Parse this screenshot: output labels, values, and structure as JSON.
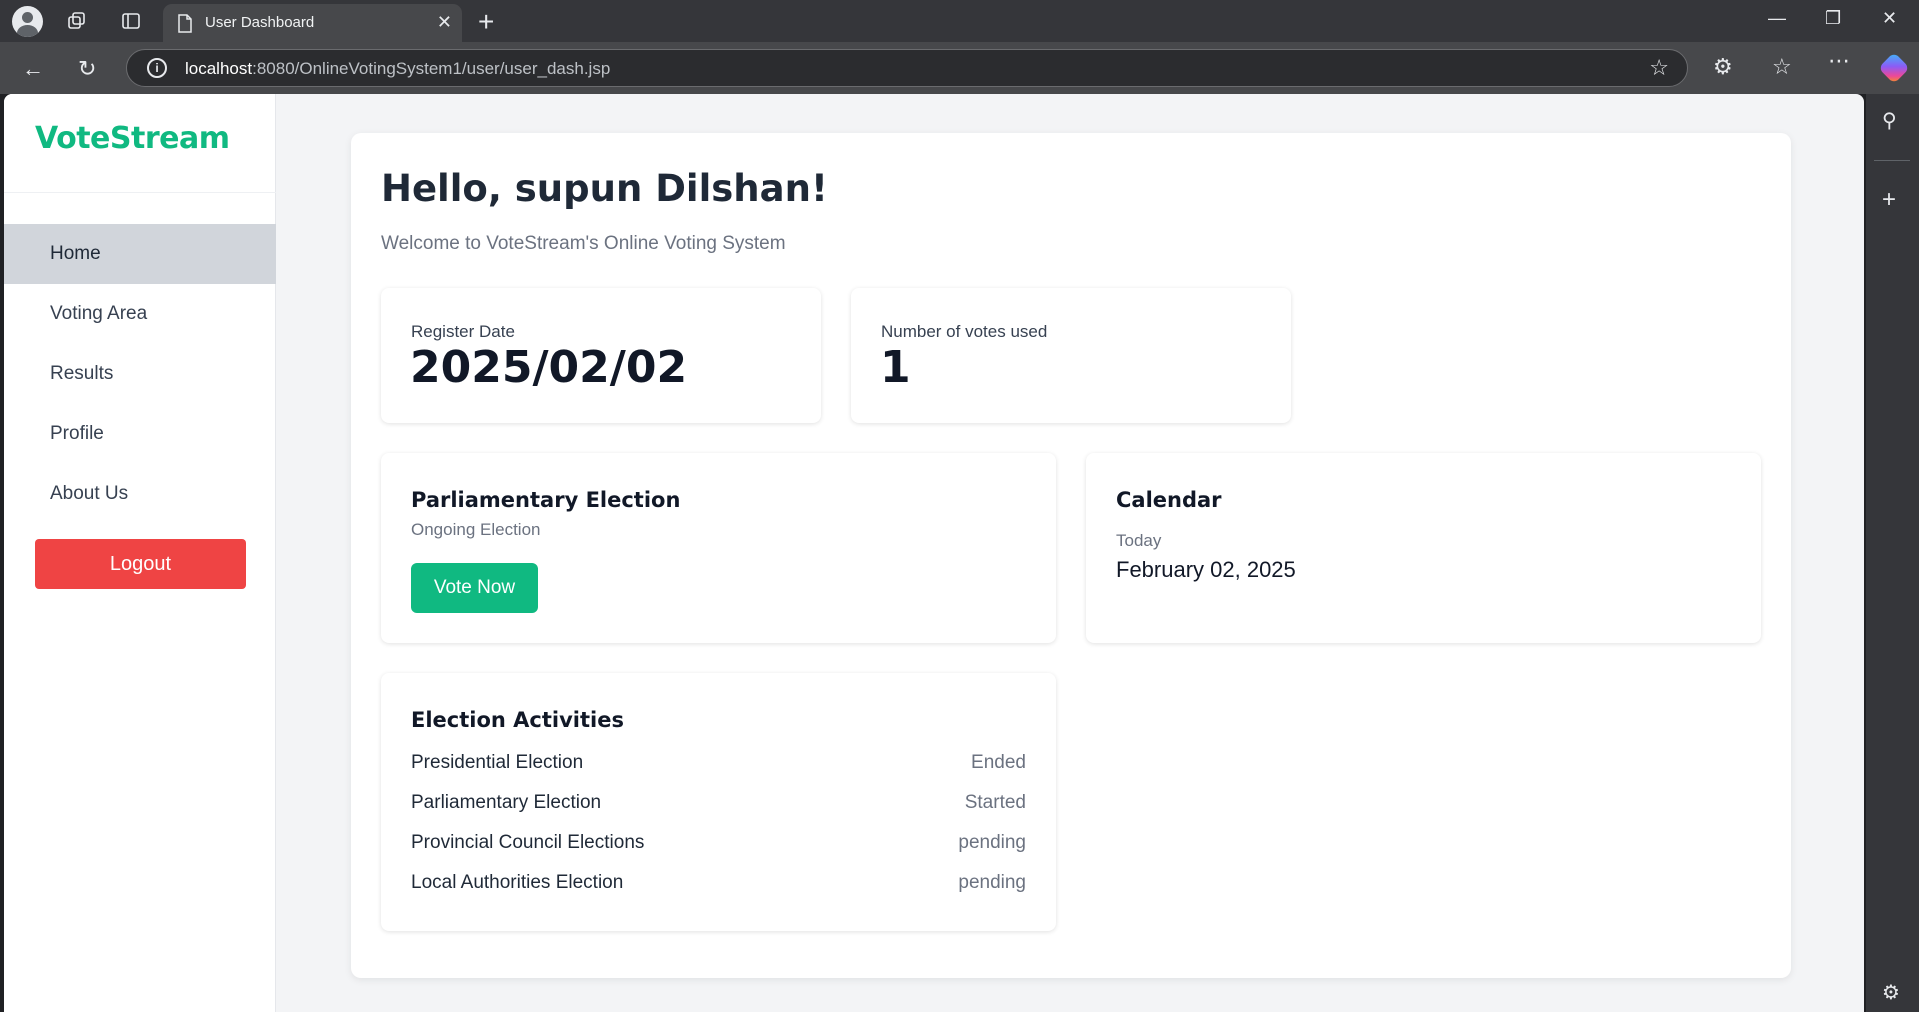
{
  "browser": {
    "tab_title": "User Dashboard",
    "url_host": "localhost",
    "url_rest": ":8080/OnlineVotingSystem1/user/user_dash.jsp"
  },
  "sidebar": {
    "brand": "VoteStream",
    "items": [
      {
        "label": "Home",
        "active": true
      },
      {
        "label": "Voting Area",
        "active": false
      },
      {
        "label": "Results",
        "active": false
      },
      {
        "label": "Profile",
        "active": false
      },
      {
        "label": "About Us",
        "active": false
      }
    ],
    "logout_label": "Logout"
  },
  "main": {
    "greeting": "Hello, supun Dilshan!",
    "welcome": "Welcome to VoteStream's Online Voting System",
    "stats": [
      {
        "label": "Register Date",
        "value": "2025/02/02"
      },
      {
        "label": "Number of votes used",
        "value": "1"
      }
    ],
    "election_card": {
      "title": "Parliamentary Election",
      "subtitle": "Ongoing Election",
      "button_label": "Vote Now"
    },
    "calendar_card": {
      "title": "Calendar",
      "subtitle": "Today",
      "date": "February 02, 2025"
    },
    "activities": {
      "title": "Election Activities",
      "rows": [
        {
          "name": "Presidential Election",
          "status": "Ended"
        },
        {
          "name": "Parliamentary Election",
          "status": "Started"
        },
        {
          "name": "Provincial Council Elections",
          "status": "pending"
        },
        {
          "name": "Local Authorities Election",
          "status": "pending"
        }
      ]
    }
  },
  "colors": {
    "brand": "#10b981",
    "logout": "#ef4444",
    "vote_button": "#10b981",
    "active_nav": "#d1d5db"
  }
}
